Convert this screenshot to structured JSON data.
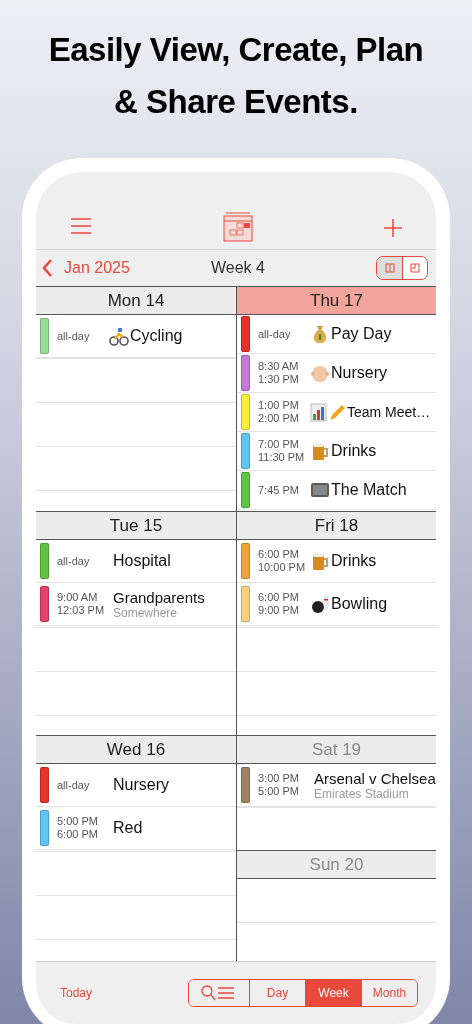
{
  "headline": "Easily View, Create, Plan & Share Events.",
  "toolbar": {
    "month_button": "Jan 2025",
    "title": "Week 4",
    "layout_toggle": [
      {
        "selected": false
      },
      {
        "selected": true
      }
    ]
  },
  "columns": [
    [
      {
        "label": "Mon 14",
        "today": false,
        "weekend": false,
        "kind": "full",
        "events": [
          {
            "color": "#98dd98",
            "time": "all-day",
            "kind": "cyclist",
            "title": "Cycling"
          }
        ]
      },
      {
        "label": "Tue 15",
        "today": false,
        "weekend": false,
        "kind": "full",
        "events": [
          {
            "color": "#5ec443",
            "time": "all-day",
            "kind": "plain",
            "title": "Hospital"
          },
          {
            "color": "#e8416b",
            "start": "9:00 AM",
            "end": "12:03 PM",
            "kind": "plain",
            "title": "Grandparents",
            "location": "Somewhere"
          }
        ]
      },
      {
        "label": "Wed 16",
        "today": false,
        "weekend": false,
        "kind": "full",
        "events": [
          {
            "color": "#e8332a",
            "time": "all-day",
            "kind": "plain",
            "title": "Nursery"
          },
          {
            "color": "#5ec6f5",
            "start": "5:00 PM",
            "end": "6:00 PM",
            "kind": "plain",
            "title": "Red"
          }
        ]
      }
    ],
    [
      {
        "label": "Thu 17",
        "today": true,
        "weekend": false,
        "kind": "full",
        "events": [
          {
            "color": "#e8332a",
            "time": "all-day",
            "kind": "money-bag",
            "title": "Pay Day"
          },
          {
            "color": "#c47ad6",
            "start": "8:30 AM",
            "end": "1:30 PM",
            "kind": "baby",
            "title": "Nursery"
          },
          {
            "color": "#f8ef3a",
            "start": "1:00 PM",
            "end": "2:00 PM",
            "kind": "chart-pencil",
            "title": "Team Meet…"
          },
          {
            "color": "#5ec6f5",
            "start": "7:00 PM",
            "end": "11:30 PM",
            "kind": "beer",
            "title": "Drinks"
          },
          {
            "color": "#5ec443",
            "start": "7:45 PM",
            "kind": "tv",
            "title": "The Match"
          }
        ]
      },
      {
        "label": "Fri 18",
        "today": false,
        "weekend": false,
        "kind": "full",
        "events": [
          {
            "color": "#f0a43a",
            "start": "6:00 PM",
            "end": "10:00 PM",
            "kind": "beer",
            "title": "Drinks"
          },
          {
            "color": "#f8d27a",
            "start": "6:00 PM",
            "end": "9:00 PM",
            "kind": "bowling",
            "title": "Bowling"
          }
        ]
      },
      {
        "label": "Sat 19",
        "today": false,
        "weekend": true,
        "kind": "half",
        "events": [
          {
            "color": "#9c8261",
            "start": "3:00 PM",
            "end": "5:00 PM",
            "kind": "plain",
            "title": "Arsenal v Chelsea",
            "location": "Emirates Stadium"
          }
        ]
      },
      {
        "label": "Sun 20",
        "today": false,
        "weekend": true,
        "kind": "half"
      }
    ]
  ],
  "bottom_bar": {
    "today_button": "Today",
    "views": [
      {
        "kind": "search",
        "selected": false
      },
      {
        "kind": "text",
        "label": "Day",
        "selected": false
      },
      {
        "kind": "text",
        "label": "Week",
        "selected": true
      },
      {
        "kind": "text",
        "label": "Month",
        "selected": false
      }
    ]
  }
}
